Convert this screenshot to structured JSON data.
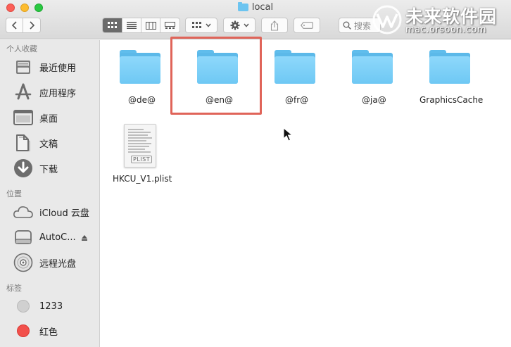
{
  "window": {
    "title": "local",
    "search_placeholder": "搜索"
  },
  "toolbar": {
    "back_icon": "chevron-left-icon",
    "forward_icon": "chevron-right-icon",
    "view_modes": [
      "icon-view",
      "list-view",
      "column-view",
      "gallery-view"
    ],
    "active_view": "icon-view"
  },
  "watermark": {
    "title": "未来软件园",
    "url": "mac.orsoon.com"
  },
  "sidebar": {
    "favorites_heading": "个人收藏",
    "favorites": [
      {
        "label": "最近使用",
        "icon": "recents-icon"
      },
      {
        "label": "应用程序",
        "icon": "applications-icon"
      },
      {
        "label": "桌面",
        "icon": "desktop-icon"
      },
      {
        "label": "文稿",
        "icon": "documents-icon"
      },
      {
        "label": "下载",
        "icon": "downloads-icon"
      }
    ],
    "locations_heading": "位置",
    "locations": [
      {
        "label": "iCloud 云盘",
        "icon": "icloud-icon"
      },
      {
        "label": "AutoC...",
        "icon": "disk-icon"
      },
      {
        "label": "远程光盘",
        "icon": "remote-disc-icon"
      }
    ],
    "tags_heading": "标签",
    "tags": [
      {
        "label": "1233",
        "color": "#d0d0d0"
      },
      {
        "label": "红色",
        "color": "#f2504b"
      }
    ]
  },
  "files": [
    {
      "name": "@de@",
      "type": "folder"
    },
    {
      "name": "@en@",
      "type": "folder",
      "highlighted": true
    },
    {
      "name": "@fr@",
      "type": "folder"
    },
    {
      "name": "@ja@",
      "type": "folder"
    },
    {
      "name": "GraphicsCache",
      "type": "folder"
    },
    {
      "name": "HKCU_V1.plist",
      "type": "plist",
      "badge": "PLIST"
    }
  ],
  "colors": {
    "folder": "#6ec8f4",
    "highlight": "#e06459",
    "sidebar_bg": "#e9e9e9"
  }
}
